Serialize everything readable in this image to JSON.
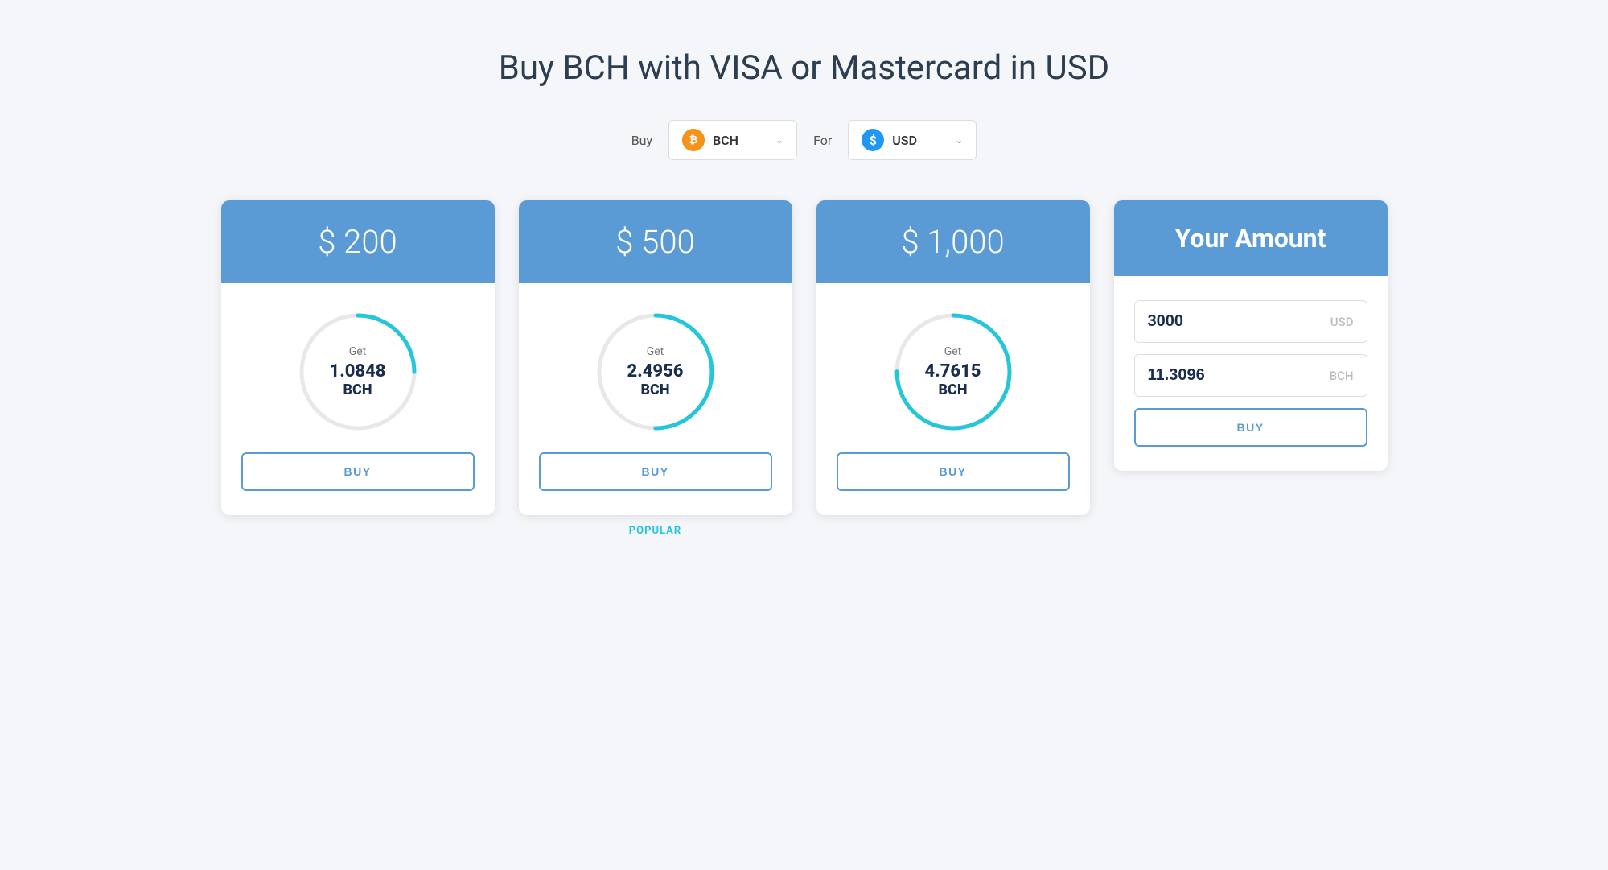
{
  "page": {
    "title": "Buy BCH with VISA or Mastercard in USD"
  },
  "selectors": {
    "buy_label": "Buy",
    "for_label": "For",
    "buy_currency": "BCH",
    "for_currency": "USD"
  },
  "cards": [
    {
      "id": "card-200",
      "header": "$ 200",
      "get_label": "Get",
      "bch_amount": "1.0848",
      "bch_unit": "BCH",
      "progress": 0.25,
      "buy_label": "BUY",
      "popular": false
    },
    {
      "id": "card-500",
      "header": "$ 500",
      "get_label": "Get",
      "bch_amount": "2.4956",
      "bch_unit": "BCH",
      "progress": 0.5,
      "buy_label": "BUY",
      "popular": true,
      "popular_label": "POPULAR"
    },
    {
      "id": "card-1000",
      "header": "$ 1,000",
      "get_label": "Get",
      "bch_amount": "4.7615",
      "bch_unit": "BCH",
      "progress": 0.75,
      "buy_label": "BUY",
      "popular": false
    }
  ],
  "custom_card": {
    "header": "Your Amount",
    "usd_value": "3000",
    "usd_label": "USD",
    "bch_value": "11.3096",
    "bch_label": "BCH",
    "buy_label": "BUY"
  }
}
